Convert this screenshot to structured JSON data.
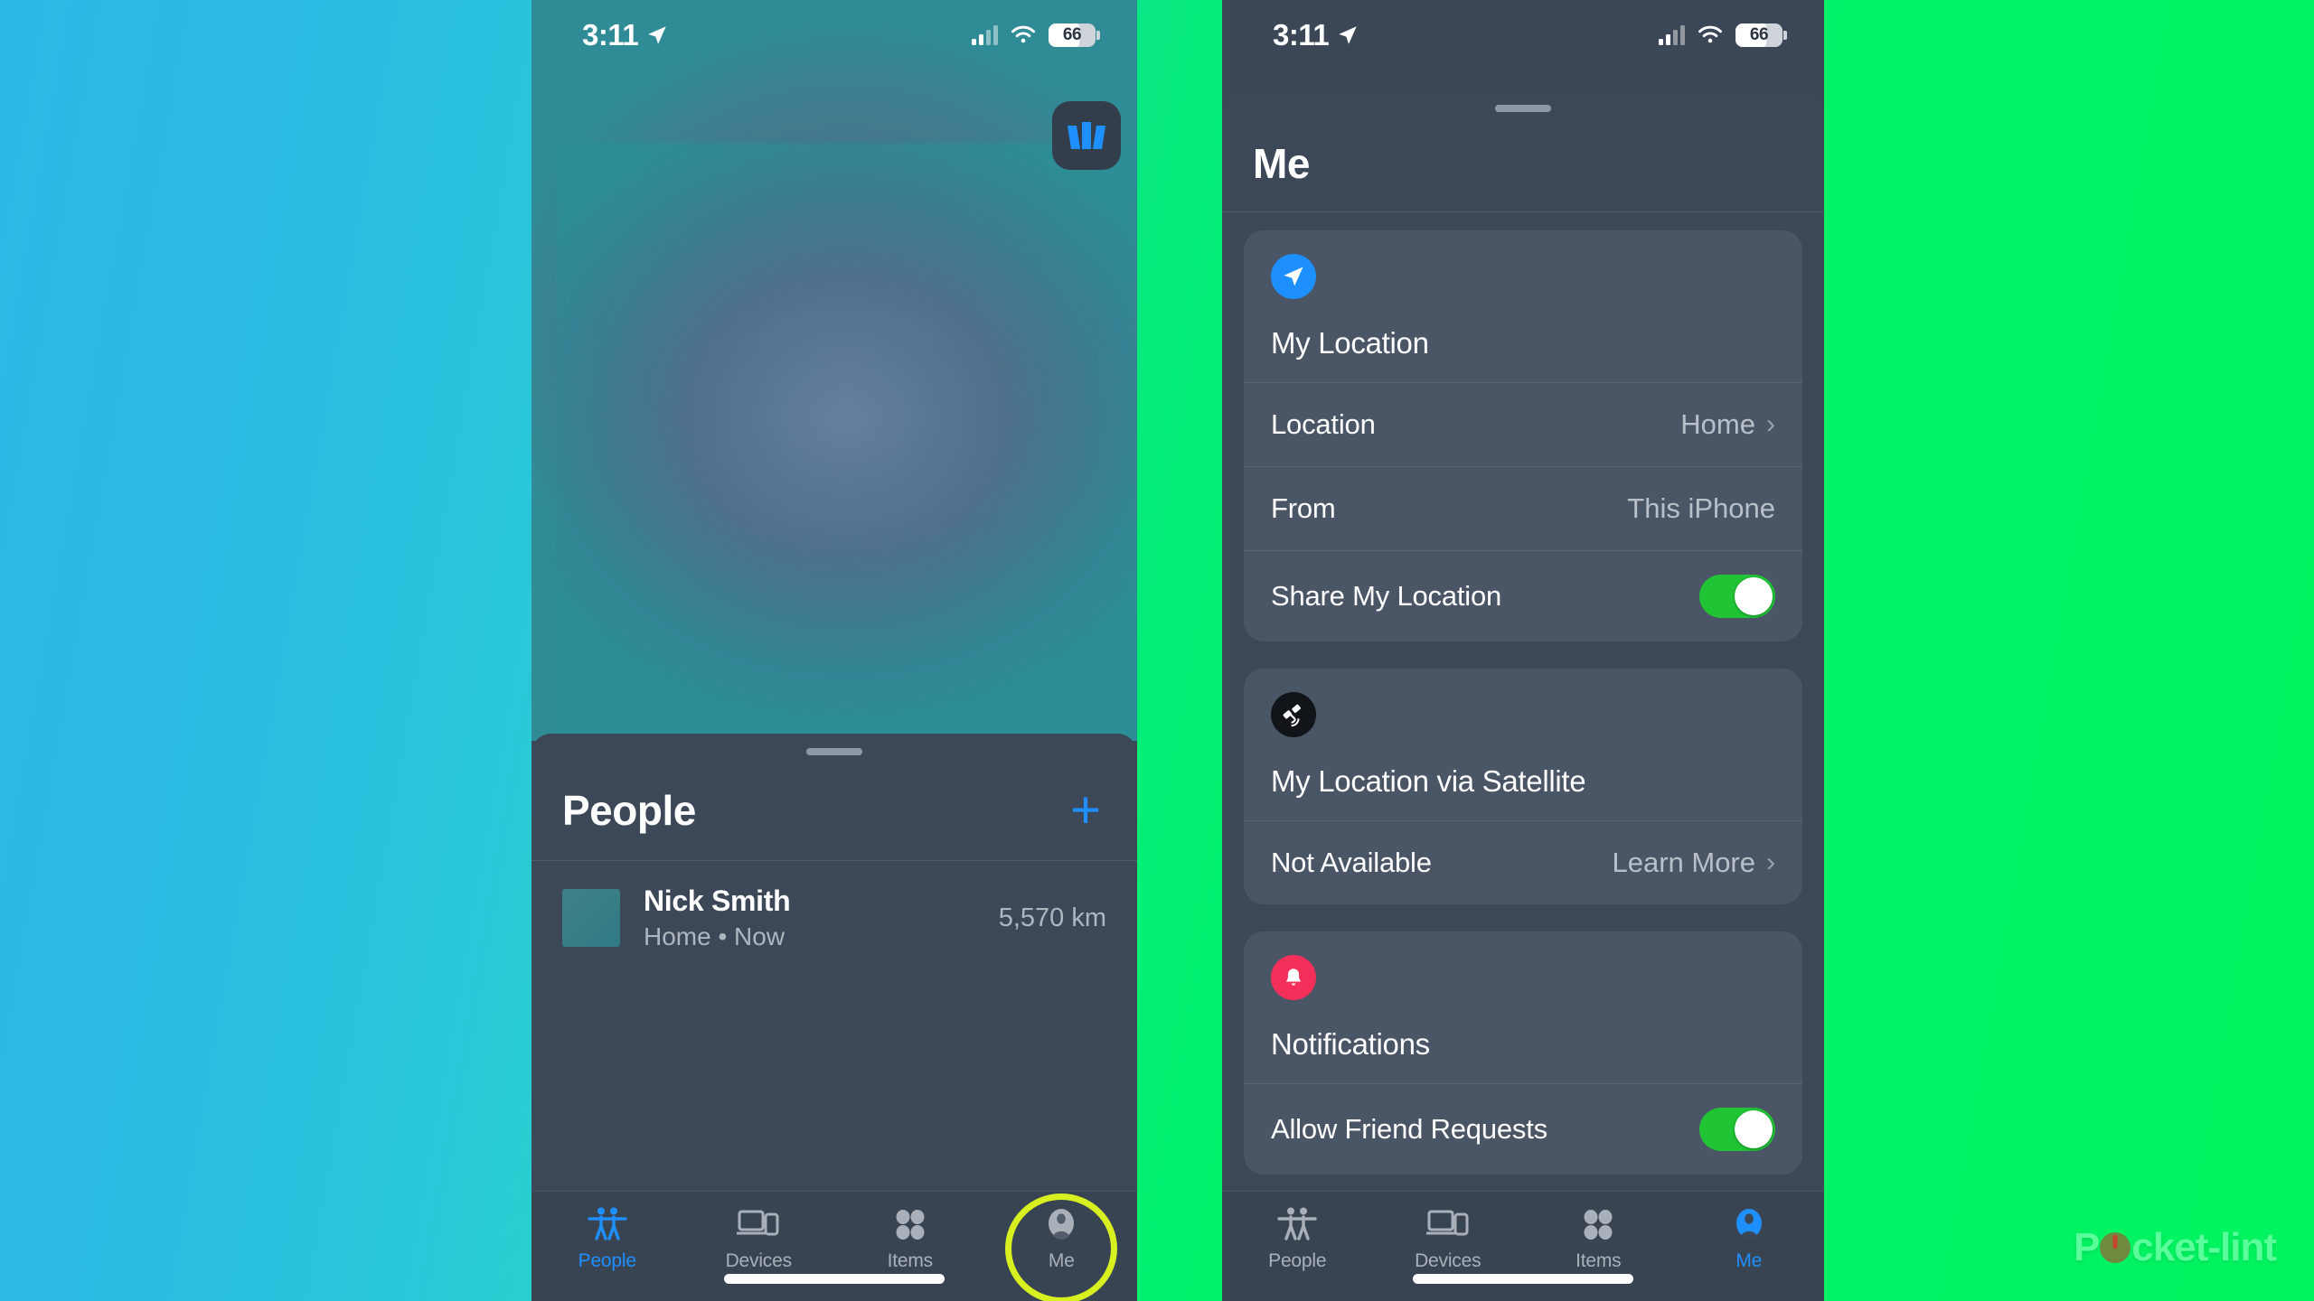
{
  "background": {
    "left_color": "#2EB8E8",
    "right_color": "#00F45F"
  },
  "status_bar": {
    "time": "3:11",
    "location_arrow_icon": "location-arrow-icon",
    "cellular_icon": "cellular-bars-icon",
    "wifi_icon": "wifi-icon",
    "battery_percent": "66"
  },
  "left_phone": {
    "map": {
      "layers_button_icon": "map-layers-icon"
    },
    "sheet": {
      "title": "People",
      "add_label": "+",
      "person": {
        "name": "Nick Smith",
        "subtitle": "Home • Now",
        "distance": "5,570 km"
      }
    },
    "tabs": [
      {
        "label": "People",
        "icon": "people-icon",
        "active": true
      },
      {
        "label": "Devices",
        "icon": "devices-icon",
        "active": false
      },
      {
        "label": "Items",
        "icon": "items-icon",
        "active": false
      },
      {
        "label": "Me",
        "icon": "person-circle-icon",
        "active": false
      }
    ],
    "highlighted_tab": "Me",
    "highlight_color": "#D8F020"
  },
  "right_phone": {
    "sheet": {
      "title": "Me"
    },
    "cards": [
      {
        "icon": "location-arrow-icon",
        "icon_color": "#1E8FFF",
        "title": "My Location",
        "rows": [
          {
            "label": "Location",
            "value": "Home",
            "type": "chevron"
          },
          {
            "label": "From",
            "value": "This iPhone",
            "type": "value"
          },
          {
            "label": "Share My Location",
            "value": "on",
            "type": "toggle"
          }
        ]
      },
      {
        "icon": "satellite-icon",
        "icon_color": "#111418",
        "title": "My Location via Satellite",
        "rows": [
          {
            "label": "Not Available",
            "value": "Learn More",
            "type": "chevron"
          }
        ]
      },
      {
        "icon": "bell-icon",
        "icon_color": "#F4305A",
        "title": "Notifications",
        "rows": [
          {
            "label": "Allow Friend Requests",
            "value": "on",
            "type": "toggle"
          }
        ]
      }
    ],
    "tabs": [
      {
        "label": "People",
        "icon": "people-icon",
        "active": false
      },
      {
        "label": "Devices",
        "icon": "devices-icon",
        "active": false
      },
      {
        "label": "Items",
        "icon": "items-icon",
        "active": false
      },
      {
        "label": "Me",
        "icon": "person-circle-icon",
        "active": true
      }
    ]
  },
  "watermark": {
    "text_before": "P",
    "text_after": "cket-lint"
  }
}
